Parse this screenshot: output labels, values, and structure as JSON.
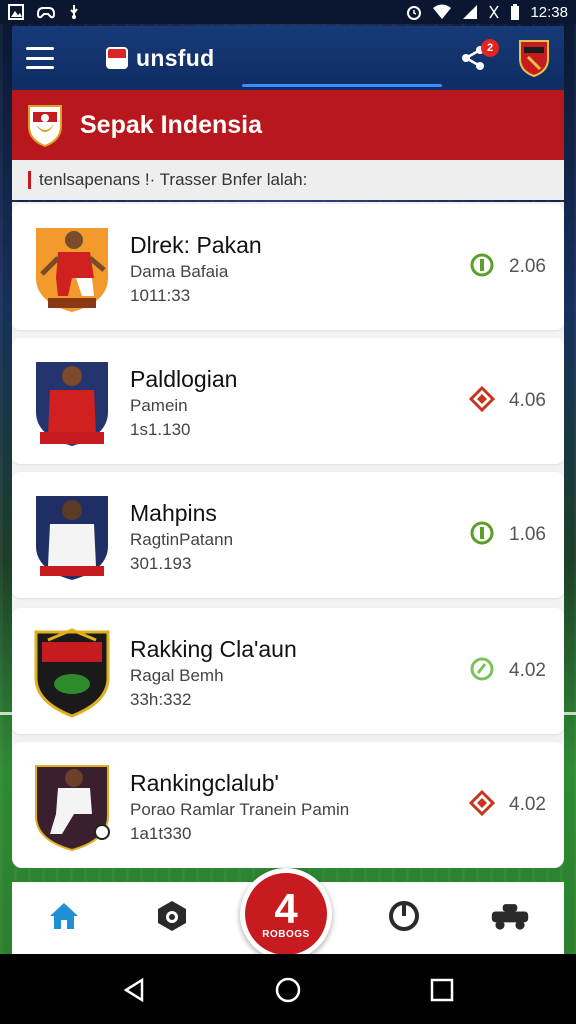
{
  "status_bar": {
    "time": "12:38"
  },
  "app_bar": {
    "title": "unsfud",
    "notification_count": "2"
  },
  "section": {
    "title": "Sepak Indensia"
  },
  "subheader": {
    "text": "tenlsapenans !· Trasser Bnfer lalah:"
  },
  "list": [
    {
      "name": "Dlrek: Pakan",
      "sub": "Dama Bafaia",
      "number": "1011:33",
      "stat": "2.06",
      "stat_icon": "circle-check-icon",
      "stat_color": "#5a9e2b",
      "avatar": "player-red-jersey"
    },
    {
      "name": "Paldlogian",
      "sub": "Pamein",
      "number": "1s1.130",
      "stat": "4.06",
      "stat_icon": "diamond-icon",
      "stat_color": "#c8351e",
      "avatar": "player-red-shirt"
    },
    {
      "name": "Mahpins",
      "sub": "RagtinPatann",
      "number": "301.193",
      "stat": "1.06",
      "stat_icon": "circle-check-icon",
      "stat_color": "#5a9e2b",
      "avatar": "player-white-shirt"
    },
    {
      "name": "Rakking Cla'aun",
      "sub": "Ragal Bemh",
      "number": "33h:332",
      "stat": "4.02",
      "stat_icon": "circle-check-icon",
      "stat_color": "#7ac25a",
      "avatar": "club-crest"
    },
    {
      "name": "Rankingclalub'",
      "sub": "Porao Ramlar Tranein Pamin",
      "number": "1a1t330",
      "stat": "4.02",
      "stat_icon": "diamond-icon",
      "stat_color": "#c8351e",
      "avatar": "player-kicking-ball"
    }
  ],
  "bottom_nav": {
    "fab_number": "4",
    "fab_label": "ROBOGS",
    "items": [
      "home-icon",
      "ball-badge-icon",
      "fab",
      "compass-icon",
      "car-icon"
    ]
  },
  "colors": {
    "brand_red": "#b8181d",
    "app_blue": "#173a78",
    "accent_blue": "#1f8fd6"
  }
}
